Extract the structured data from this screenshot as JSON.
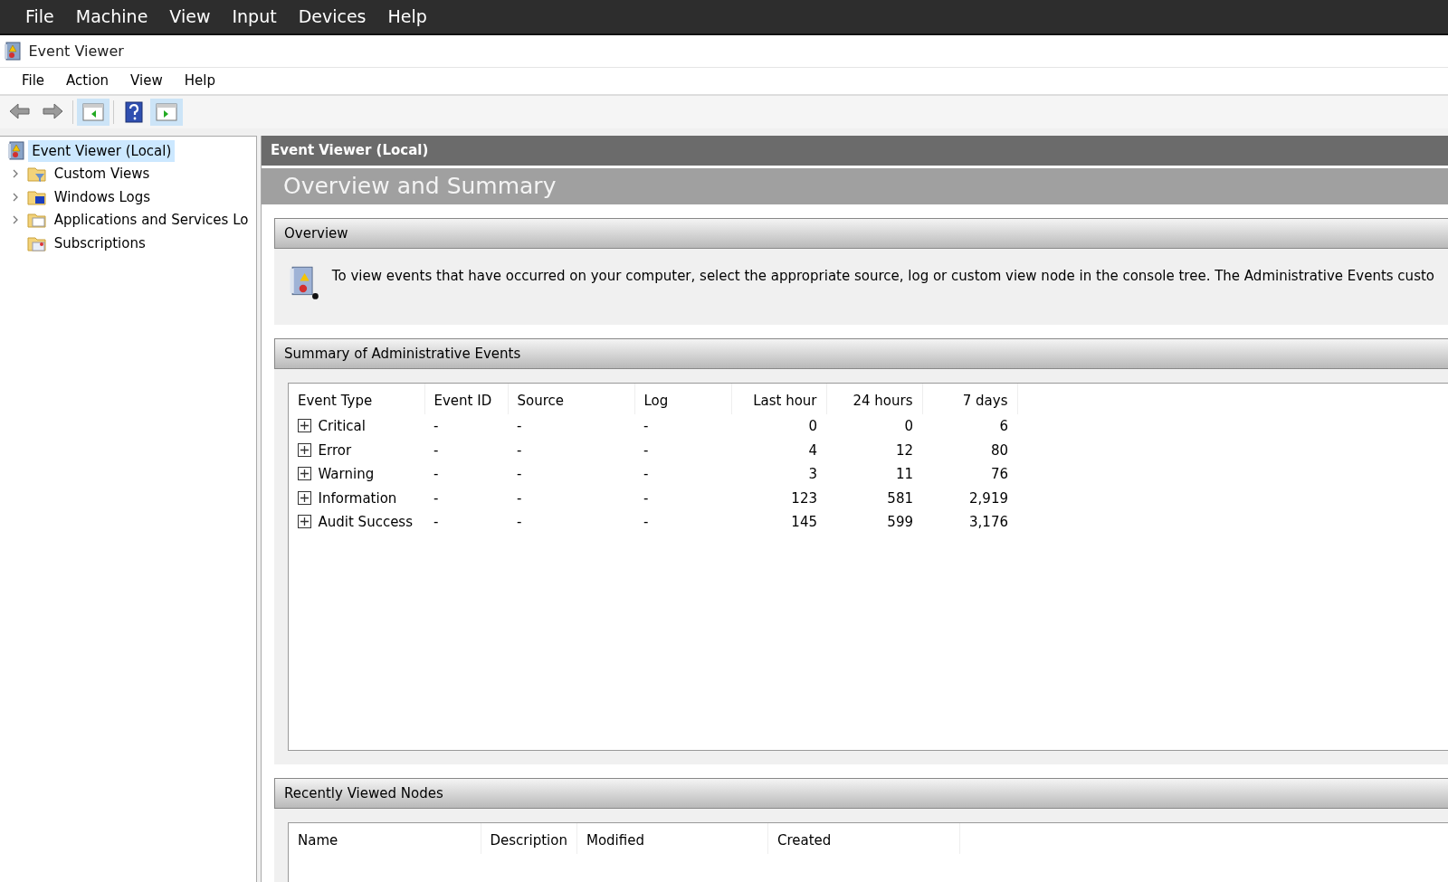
{
  "vm_menu": [
    "File",
    "Machine",
    "View",
    "Input",
    "Devices",
    "Help"
  ],
  "window": {
    "title": "Event Viewer"
  },
  "menu": [
    "File",
    "Action",
    "View",
    "Help"
  ],
  "toolbar": [
    {
      "kind": "back",
      "disabled": true,
      "pressed": false
    },
    {
      "kind": "forward",
      "disabled": true,
      "pressed": false
    },
    {
      "kind": "tree",
      "disabled": false,
      "pressed": true
    },
    {
      "kind": "help",
      "disabled": false,
      "pressed": false
    },
    {
      "kind": "actions",
      "disabled": false,
      "pressed": true
    }
  ],
  "tree": {
    "label": "Event Viewer (Local)",
    "selected": true,
    "children": [
      {
        "label": "Custom Views",
        "kind": "filter",
        "selected": false,
        "expandable": true
      },
      {
        "label": "Windows Logs",
        "kind": "logs",
        "selected": false,
        "expandable": true
      },
      {
        "label": "Applications and Services Lo",
        "kind": "folder",
        "selected": false,
        "expandable": true
      },
      {
        "label": "Subscriptions",
        "kind": "subs",
        "selected": false,
        "expandable": false
      }
    ]
  },
  "content": {
    "header": "Event Viewer (Local)",
    "title": "Overview and Summary",
    "overview": {
      "heading": "Overview",
      "text": "To view events that have occurred on your computer, select the appropriate source, log or custom view node in the console tree. The Administrative Events custo"
    },
    "summary": {
      "heading": "Summary of Administrative Events",
      "columns": [
        {
          "label": "Event Type",
          "kind": "text"
        },
        {
          "label": "Event ID",
          "kind": "text"
        },
        {
          "label": "Source",
          "kind": "text"
        },
        {
          "label": "Log",
          "kind": "text"
        },
        {
          "label": "Last hour",
          "kind": "number"
        },
        {
          "label": "24 hours",
          "kind": "number"
        },
        {
          "label": "7 days",
          "kind": "number"
        }
      ],
      "rows": [
        {
          "expanded": false,
          "cells": [
            "Critical",
            "-",
            "-",
            "-",
            "0",
            "0",
            "6"
          ]
        },
        {
          "expanded": false,
          "cells": [
            "Error",
            "-",
            "-",
            "-",
            "4",
            "12",
            "80"
          ]
        },
        {
          "expanded": false,
          "cells": [
            "Warning",
            "-",
            "-",
            "-",
            "3",
            "11",
            "76"
          ]
        },
        {
          "expanded": false,
          "cells": [
            "Information",
            "-",
            "-",
            "-",
            "123",
            "581",
            "2,919"
          ]
        },
        {
          "expanded": false,
          "cells": [
            "Audit Success",
            "-",
            "-",
            "-",
            "145",
            "599",
            "3,176"
          ]
        }
      ]
    },
    "recent": {
      "heading": "Recently Viewed Nodes",
      "columns": [
        "Name",
        "Description",
        "Modified",
        "Created"
      ]
    }
  }
}
